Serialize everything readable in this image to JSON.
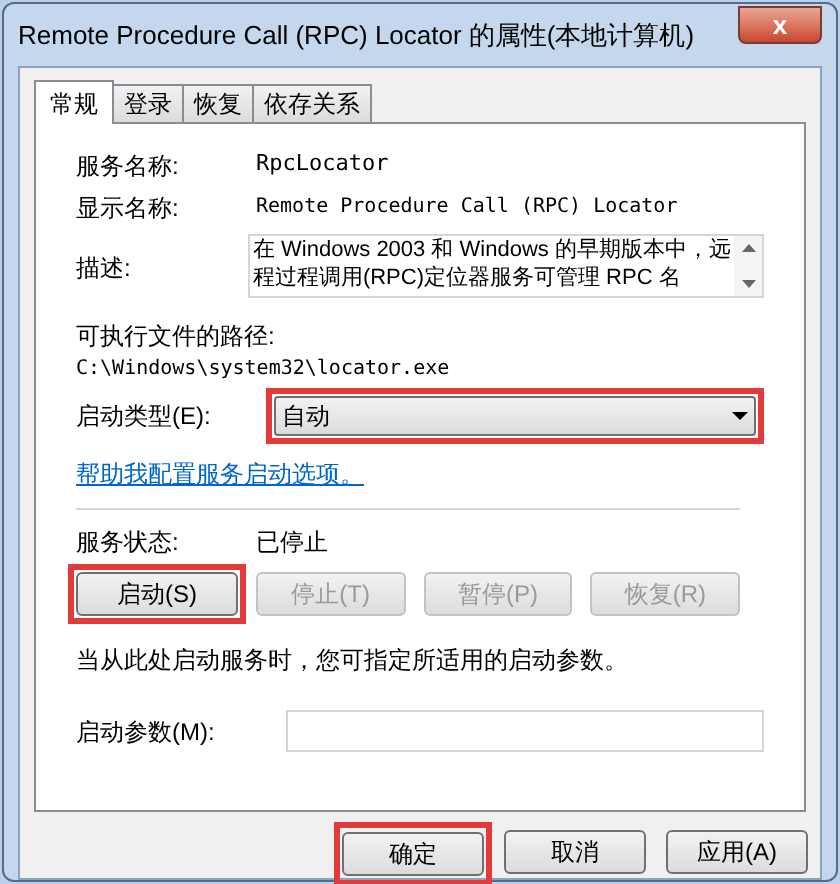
{
  "window": {
    "title": "Remote Procedure Call (RPC) Locator 的属性(本地计算机)",
    "close": "x"
  },
  "tabs": [
    {
      "label": "常规",
      "selected": true
    },
    {
      "label": "登录",
      "selected": false
    },
    {
      "label": "恢复",
      "selected": false
    },
    {
      "label": "依存关系",
      "selected": false
    }
  ],
  "service_name": {
    "label": "服务名称:",
    "value": "RpcLocator"
  },
  "display_name": {
    "label": "显示名称:",
    "value": "Remote Procedure Call (RPC) Locator"
  },
  "description": {
    "label": "描述:",
    "value": "在 Windows 2003 和 Windows 的早期版本中，远程过程调用(RPC)定位器服务可管理 RPC 名"
  },
  "path": {
    "label": "可执行文件的路径:",
    "value": "C:\\Windows\\system32\\locator.exe"
  },
  "startup_type": {
    "label": "启动类型(E):",
    "value": "自动",
    "highlighted": true
  },
  "help_link": "帮助我配置服务启动选项。",
  "service_status": {
    "label": "服务状态:",
    "value": "已停止"
  },
  "service_buttons": [
    {
      "label": "启动(S)",
      "disabled": false,
      "highlighted": true
    },
    {
      "label": "停止(T)",
      "disabled": true,
      "highlighted": false
    },
    {
      "label": "暂停(P)",
      "disabled": true,
      "highlighted": false
    },
    {
      "label": "恢复(R)",
      "disabled": true,
      "highlighted": false
    }
  ],
  "hint": "当从此处启动服务时，您可指定所适用的启动参数。",
  "start_parameters": {
    "label": "启动参数(M):"
  },
  "dialog_buttons": [
    {
      "label": "确定",
      "highlighted": true
    },
    {
      "label": "取消",
      "highlighted": false
    },
    {
      "label": "应用(A)",
      "highlighted": false
    }
  ]
}
